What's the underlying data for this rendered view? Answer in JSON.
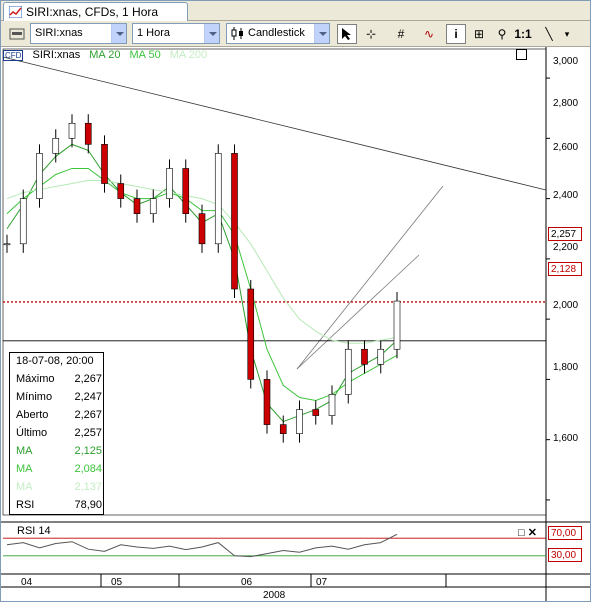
{
  "tab": {
    "title": "SIRI:xnas, CFDs, 1 Hora"
  },
  "toolbar": {
    "symbol": "SIRI:xnas",
    "timeframe": "1 Hora",
    "chart_type": "Candlestick",
    "ratio": "1:1"
  },
  "legend": {
    "cfd": "CFD",
    "symbol": "SIRI:xnas",
    "ma20": "MA 20",
    "ma50": "MA 50",
    "ma200": "MA 200"
  },
  "colors": {
    "ma20": "#2e9e2e",
    "ma50": "#3cc43c",
    "ma200": "#b6eab6",
    "resistance": "#c00000",
    "bg": "#ffffff",
    "up": "#ffffff",
    "down": "#cc0000"
  },
  "price_labels": {
    "last": "2,257",
    "hline": "2,128"
  },
  "y_ticks": [
    "3,000",
    "2,800",
    "2,600",
    "2,400",
    "2,200",
    "2,000",
    "1,800",
    "1,600"
  ],
  "x_labels": [
    "04",
    "05",
    "06",
    "07"
  ],
  "x_year": "2008",
  "info": {
    "date": "18-07-08, 20:00",
    "rows": [
      {
        "k": "Máximo",
        "v": "2,267",
        "color": "#000000"
      },
      {
        "k": "Mínimo",
        "v": "2,247",
        "color": "#000000"
      },
      {
        "k": "Aberto",
        "v": "2,267",
        "color": "#000000"
      },
      {
        "k": "Último",
        "v": "2,257",
        "color": "#000000"
      },
      {
        "k": "MA",
        "v": "2,125",
        "color": "#2e9e2e"
      },
      {
        "k": "MA",
        "v": "2,084",
        "color": "#3cc43c"
      },
      {
        "k": "MA",
        "v": "2,137",
        "color": "#c4ecc4"
      },
      {
        "k": "RSI",
        "v": "78,90",
        "color": "#000000"
      }
    ]
  },
  "rsi": {
    "title": "RSI 14",
    "upper": "70,00",
    "lower": "30,00"
  },
  "chart_data": {
    "type": "line",
    "title": "SIRI:xnas, CFDs, 1 Hora",
    "x": [
      "04",
      "05",
      "06",
      "07"
    ],
    "ylim": [
      1.55,
      3.05
    ],
    "series": [
      {
        "name": "SIRI:xnas",
        "values": [
          2.45,
          2.6,
          2.75,
          2.8,
          2.85,
          2.78,
          2.65,
          2.6,
          2.55,
          2.6,
          2.7,
          2.55,
          2.45,
          2.75,
          2.3,
          2.0,
          1.85,
          1.82,
          1.9,
          1.88,
          1.95,
          2.1,
          2.05,
          2.1,
          2.26
        ]
      },
      {
        "name": "MA 20",
        "values": [
          2.5,
          2.58,
          2.68,
          2.74,
          2.78,
          2.76,
          2.68,
          2.62,
          2.58,
          2.6,
          2.64,
          2.58,
          2.52,
          2.55,
          2.4,
          2.1,
          1.92,
          1.86,
          1.88,
          1.9,
          1.93,
          2.02,
          2.05,
          2.08,
          2.13
        ]
      },
      {
        "name": "MA 50",
        "values": [
          2.55,
          2.6,
          2.64,
          2.68,
          2.7,
          2.7,
          2.66,
          2.62,
          2.6,
          2.6,
          2.62,
          2.6,
          2.56,
          2.56,
          2.48,
          2.3,
          2.1,
          1.98,
          1.94,
          1.93,
          1.95,
          1.99,
          2.02,
          2.05,
          2.08
        ]
      },
      {
        "name": "MA 200",
        "values": [
          2.6,
          2.62,
          2.63,
          2.64,
          2.65,
          2.66,
          2.66,
          2.65,
          2.64,
          2.63,
          2.62,
          2.61,
          2.6,
          2.58,
          2.52,
          2.45,
          2.36,
          2.27,
          2.2,
          2.16,
          2.13,
          2.12,
          2.12,
          2.13,
          2.14
        ]
      }
    ],
    "rsi": [
      55,
      60,
      48,
      58,
      62,
      45,
      40,
      55,
      50,
      47,
      52,
      44,
      50,
      60,
      30,
      28,
      35,
      42,
      38,
      48,
      52,
      45,
      55,
      60,
      78.9
    ]
  }
}
